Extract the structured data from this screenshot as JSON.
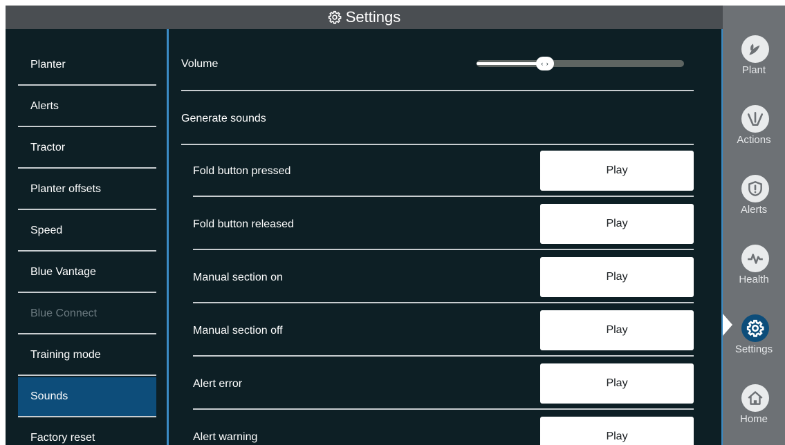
{
  "header": {
    "title": "Settings",
    "icon": "gear-icon"
  },
  "menu": {
    "items": [
      {
        "label": "Planter",
        "state": "normal"
      },
      {
        "label": "Alerts",
        "state": "normal"
      },
      {
        "label": "Tractor",
        "state": "normal"
      },
      {
        "label": "Planter offsets",
        "state": "normal"
      },
      {
        "label": "Speed",
        "state": "normal"
      },
      {
        "label": "Blue Vantage",
        "state": "normal"
      },
      {
        "label": "Blue Connect",
        "state": "disabled"
      },
      {
        "label": "Training mode",
        "state": "normal"
      },
      {
        "label": "Sounds",
        "state": "selected"
      },
      {
        "label": "Factory reset",
        "state": "normal"
      }
    ]
  },
  "sounds": {
    "volume_label": "Volume",
    "volume_level": 0.33,
    "volume_thumb_glyph": "‹ ›",
    "generate_label": "Generate sounds",
    "rows": [
      {
        "label": "Fold button pressed",
        "button": "Play"
      },
      {
        "label": "Fold button released",
        "button": "Play"
      },
      {
        "label": "Manual section on",
        "button": "Play"
      },
      {
        "label": "Manual section off",
        "button": "Play"
      },
      {
        "label": "Alert error",
        "button": "Play"
      },
      {
        "label": "Alert warning",
        "button": "Play"
      }
    ]
  },
  "nav": {
    "items": [
      {
        "label": "Plant",
        "icon": "plant-icon"
      },
      {
        "label": "Actions",
        "icon": "actions-icon"
      },
      {
        "label": "Alerts",
        "icon": "alert-shield-icon"
      },
      {
        "label": "Health",
        "icon": "health-pulse-icon"
      },
      {
        "label": "Settings",
        "icon": "gear-icon",
        "active": true
      },
      {
        "label": "Home",
        "icon": "home-icon"
      }
    ]
  },
  "colors": {
    "content_bg": "#0d1f25",
    "selected_item": "#0d4d7a",
    "accent_blue": "#3b8bc5",
    "nav_bg": "#6d7175",
    "header_bg": "#4a4e52"
  }
}
